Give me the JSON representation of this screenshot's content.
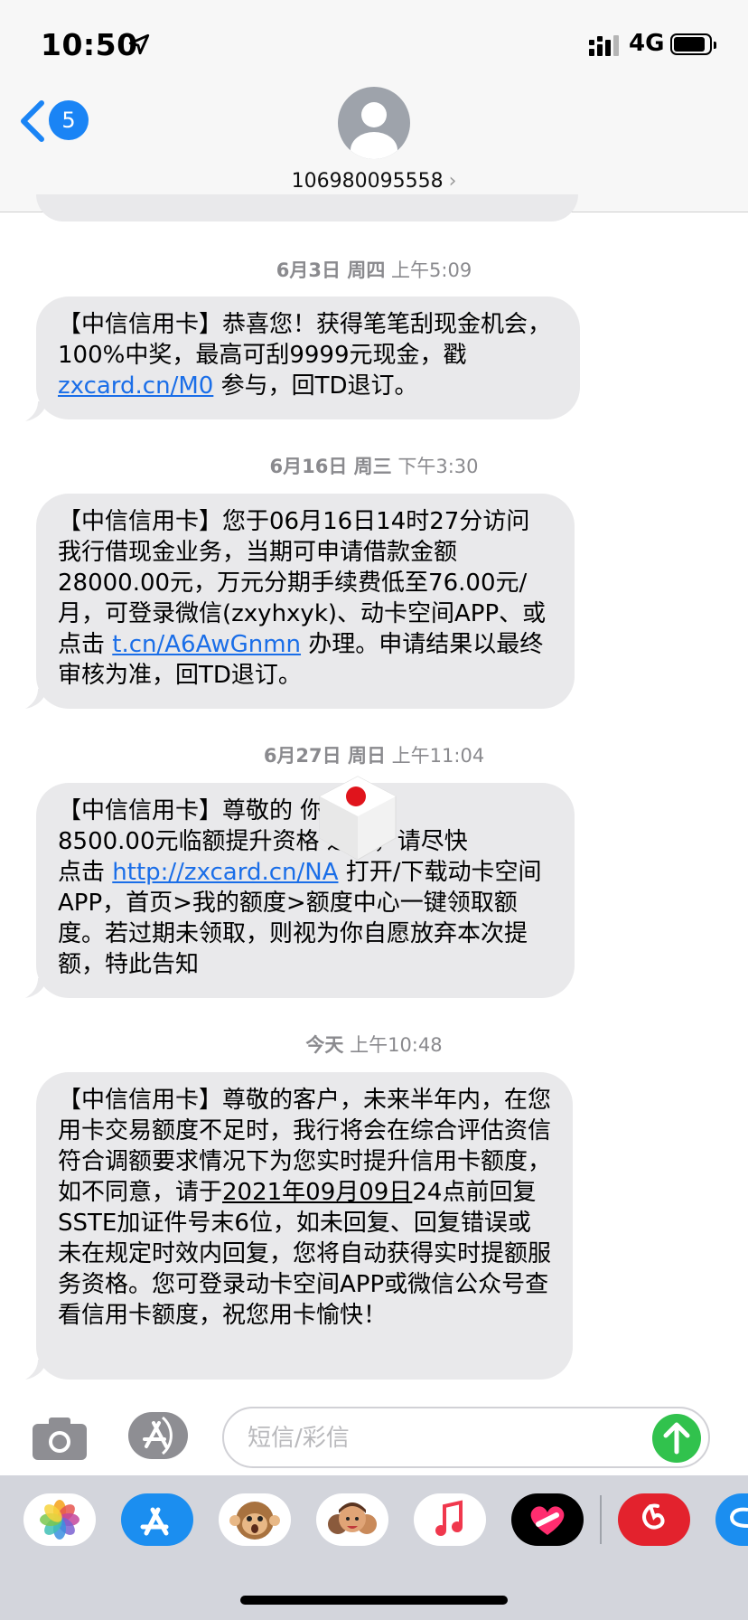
{
  "status_bar": {
    "time": "10:50",
    "network": "4G",
    "battery_level": 0.85
  },
  "header": {
    "back_badge": "5",
    "contact_number": "106980095558",
    "contact_chevron": "›"
  },
  "messages": [
    {
      "timestamp_date": "6月3日 周四",
      "timestamp_time": "上午5:09",
      "before": "【中信信用卡】恭喜您！获得笔笔刮现金机会，100%中奖，最高可刮9999元现金，戳\n",
      "link": "zxcard.cn/M0",
      "after": " 参与，回TD退订。"
    },
    {
      "timestamp_date": "6月16日 周三",
      "timestamp_time": "下午3:30",
      "before": "【中信信用卡】您于06月16日14时27分访问我行借现金业务，当期可申请借款金额28000.00元，万元分期手续费低至76.00元/月，可登录微信(zxyhxyk)、动卡空间APP、或点击 ",
      "link": "t.cn/A6AwGnmn",
      "after": " 办理。申请结果以最终审核为准，回TD退订。"
    },
    {
      "timestamp_date": "6月27日 周日",
      "timestamp_time": "上午11:04",
      "before": "【中信信用卡】尊敬的        你的\n8500.00元临额提升资格    过期，请尽快\n点击  ",
      "link": "http://zxcard.cn/NA",
      "after": "  打开/下载动卡空间APP，首页>我的额度>额度中心一键领取额度。若过期未领取，则视为你自愿放弃本次提额，特此告知"
    },
    {
      "timestamp_date": "今天",
      "timestamp_time": "上午10:48",
      "before": "【中信信用卡】尊敬的客户，未来半年内，在您用卡交易额度不足时，我行将会在综合评估资信符合调额要求情况下为您实时提升信用卡额度，如不同意，请于",
      "underline": "2021年09月09日",
      "after": "24点前回复SSTE加证件号末6位，如未回复、回复错误或未在规定时效内回复，您将自动获得实时提额服务资格。您可登录动卡空间APP或微信公众号查看信用卡额度，祝您用卡愉快！"
    }
  ],
  "input": {
    "placeholder": "短信/彩信"
  },
  "app_drawer": [
    {
      "name": "photos-icon"
    },
    {
      "name": "app-store-icon"
    },
    {
      "name": "animoji-icon"
    },
    {
      "name": "memoji-icon"
    },
    {
      "name": "music-icon"
    },
    {
      "name": "digital-touch-icon"
    },
    {
      "name": "netease-music-icon"
    },
    {
      "name": "partial-app-icon"
    }
  ]
}
